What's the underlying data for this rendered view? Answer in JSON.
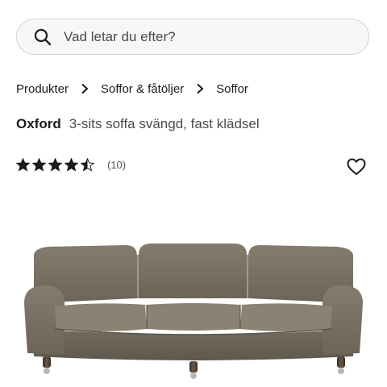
{
  "search": {
    "placeholder": "Vad letar du efter?",
    "icon": "search-icon"
  },
  "breadcrumb": [
    {
      "label": "Produkter"
    },
    {
      "label": "Soffor & fåtöljer"
    },
    {
      "label": "Soffor"
    }
  ],
  "product": {
    "brand": "Oxford",
    "subtitle": "3-sits soffa svängd, fast klädsel",
    "rating": 4.5,
    "rating_max": 5,
    "review_count": "(10)",
    "image": "curved-three-seat-sofa",
    "fabric_color": "#7a7263"
  },
  "icons": {
    "favorite": "heart-icon",
    "separator": "chevron-right-icon"
  }
}
